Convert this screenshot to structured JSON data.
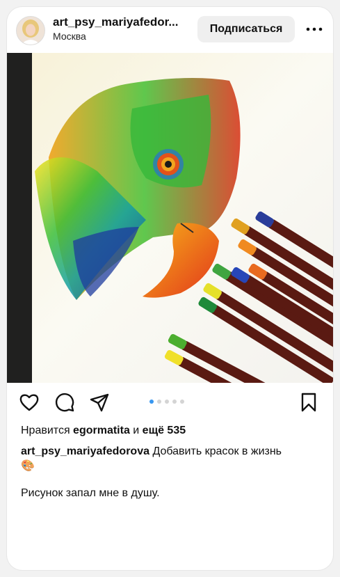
{
  "post": {
    "username": "art_psy_mariyafedor...",
    "location": "Москва",
    "follow_label": "Подписаться",
    "more_label": "•••"
  },
  "likes": {
    "prefix": "Нравится ",
    "user": "egormatita",
    "middle": " и ",
    "others": "ещё 535"
  },
  "caption": {
    "username": "art_psy_mariyafedorova",
    "text": "Добавить красок в жизнь",
    "emoji": "🎨"
  },
  "comment": {
    "text": "Рисунок запал мне в душу."
  },
  "carousel": {
    "count": 5,
    "active_index": 1
  },
  "colors": {
    "accent": "#3897f0",
    "follow_bg": "#efefef"
  },
  "icons": [
    "heart-icon",
    "comment-icon",
    "share-icon",
    "bookmark-icon",
    "more-icon"
  ]
}
